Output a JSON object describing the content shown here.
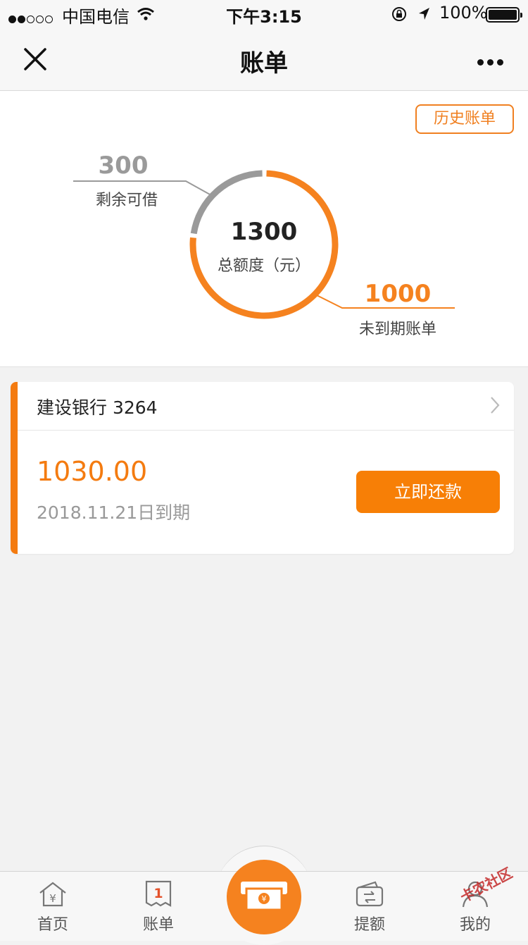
{
  "status_bar": {
    "carrier": "中国电信",
    "time": "下午3:15",
    "battery": "100%",
    "icons": [
      "signal-dots-icon",
      "wifi-icon",
      "rotation-lock-icon",
      "location-arrow-icon",
      "battery-icon"
    ]
  },
  "nav": {
    "title": "账单",
    "close_icon": "close-icon",
    "more_icon": "more-icon"
  },
  "summary": {
    "history_label": "历史账单",
    "total_value": "1300",
    "total_label": "总额度（元）",
    "remaining_value": "300",
    "remaining_label": "剩余可借",
    "due_value": "1000",
    "due_label": "未到期账单",
    "ring_fraction_due": 0.769,
    "colors": {
      "due": "#f5821f",
      "remaining": "#9a9a9a"
    }
  },
  "card": {
    "bank": "建设银行 3264",
    "amount": "1030.00",
    "due_date": "2018.11.21日到期",
    "pay_label": "立即还款",
    "accent_color": "#f47b10"
  },
  "tabs": [
    {
      "label": "首页",
      "icon": "home-yen-icon"
    },
    {
      "label": "账单",
      "icon": "bill-icon",
      "badge": "1"
    },
    {
      "label": "",
      "icon": "cash-center-icon"
    },
    {
      "label": "提额",
      "icon": "wallet-icon"
    },
    {
      "label": "我的",
      "icon": "user-icon"
    }
  ],
  "watermark": "卡农社区"
}
